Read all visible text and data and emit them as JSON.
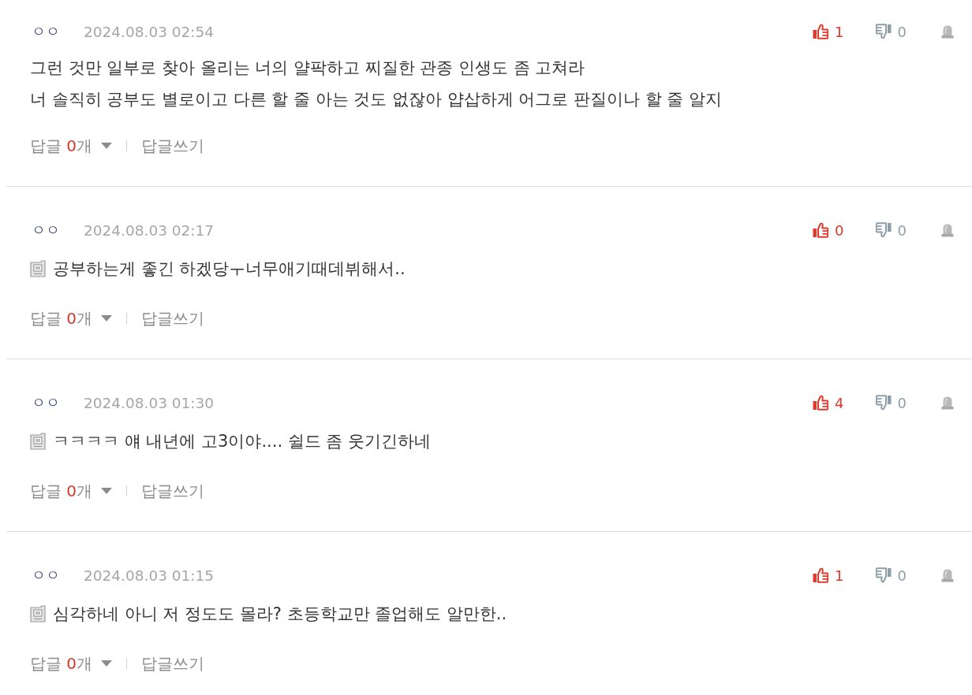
{
  "comments": [
    {
      "author": "ㅇㅇ",
      "date": "2024.08.03 02:54",
      "doc_icon": false,
      "text": "그런 것만 일부로 찾아 올리는 너의 얄팍하고 찌질한 관종 인생도 좀 고쳐라\n너 솔직히 공부도 별로이고 다른 할 줄 아는 것도 없잖아 얍삽하게 어그로 판질이나 할 줄 알지",
      "likes": "1",
      "dislikes": "0",
      "reply_label": "답글",
      "reply_count": "0",
      "reply_unit": "개",
      "write_reply": "답글쓰기"
    },
    {
      "author": "ㅇㅇ",
      "date": "2024.08.03 02:17",
      "doc_icon": true,
      "text": "공부하는게 좋긴 하겠당ㅜ너무애기때데뷔해서..",
      "likes": "0",
      "dislikes": "0",
      "reply_label": "답글",
      "reply_count": "0",
      "reply_unit": "개",
      "write_reply": "답글쓰기"
    },
    {
      "author": "ㅇㅇ",
      "date": "2024.08.03 01:30",
      "doc_icon": true,
      "text": "ㅋㅋㅋㅋ 얘 내년에 고3이야.... 쉴드 좀 웃기긴하네",
      "likes": "4",
      "dislikes": "0",
      "reply_label": "답글",
      "reply_count": "0",
      "reply_unit": "개",
      "write_reply": "답글쓰기"
    },
    {
      "author": "ㅇㅇ",
      "date": "2024.08.03 01:15",
      "doc_icon": true,
      "text": "심각하네 아니 저 정도도 몰라? 초등학교만 졸업해도 알만한..",
      "likes": "1",
      "dislikes": "0",
      "reply_label": "답글",
      "reply_count": "0",
      "reply_unit": "개",
      "write_reply": "답글쓰기"
    }
  ]
}
